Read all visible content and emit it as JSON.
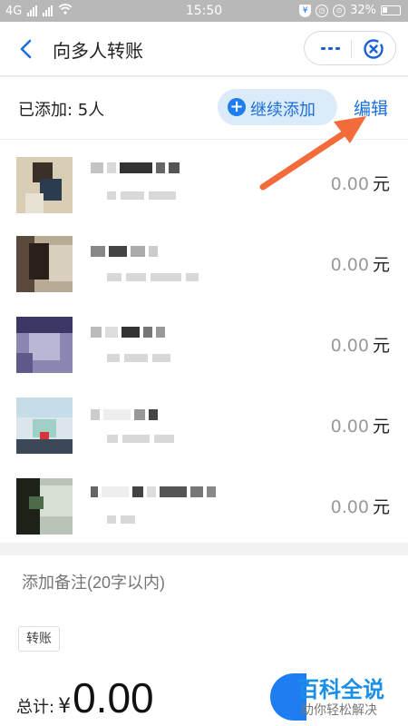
{
  "status_bar": {
    "carrier_left": "4G",
    "time": "15:50",
    "battery": "32%"
  },
  "nav": {
    "title": "向多人转账",
    "more_icon": "more-dots-icon",
    "close_icon": "close-circle-icon"
  },
  "added": {
    "label": "已添加: 5人",
    "add_more": "继续添加",
    "edit": "编辑"
  },
  "recipients": [
    {
      "amount": "0.00",
      "unit": "元"
    },
    {
      "amount": "0.00",
      "unit": "元"
    },
    {
      "amount": "0.00",
      "unit": "元"
    },
    {
      "amount": "0.00",
      "unit": "元"
    },
    {
      "amount": "0.00",
      "unit": "元"
    }
  ],
  "remark": {
    "placeholder": "添加备注(20字以内)"
  },
  "tag": "转账",
  "total": {
    "label": "总计:",
    "symbol": "¥",
    "value": "0.00"
  },
  "watermark": {
    "title": "百科全说",
    "subtitle": "助你轻松解决"
  },
  "colors": {
    "accent": "#1a6fd8",
    "add_bg": "#dcebfa",
    "arrow": "#f26b3a"
  }
}
